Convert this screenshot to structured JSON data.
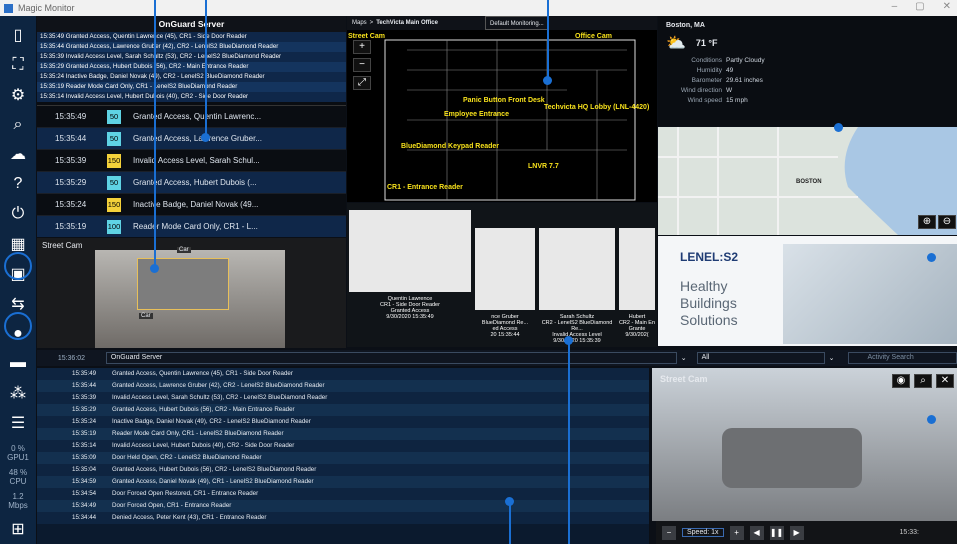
{
  "app": {
    "title": "Magic Monitor"
  },
  "sidebar": {
    "stats": [
      {
        "value": "0 %",
        "label": "GPU1"
      },
      {
        "value": "48 %",
        "label": "CPU"
      },
      {
        "value": "1.2",
        "label": "Mbps"
      }
    ]
  },
  "onguard_top": {
    "title": "OnGuard Server",
    "events": [
      "15:35:49  Granted Access, Quentin Lawrence (45), CR1 - Side Door Reader",
      "15:35:44  Granted Access, Lawrence Gruber (42), CR2 - LenelS2 BlueDiamond Reader",
      "15:35:39  Invalid Access Level, Sarah Schultz (53), CR2 - LenelS2 BlueDiamond Reader",
      "15:35:29  Granted Access, Hubert Dubois (56), CR2 - Main Entrance Reader",
      "15:35:24  Inactive Badge, Daniel Novak (49), CR2 - LenelS2 BlueDiamond Reader",
      "15:35:19  Reader Mode Card Only, CR1 - LenelS2 BlueDiamond Reader",
      "15:35:14  Invalid Access Level, Hubert Dubois (40), CR2 - Side Door Reader"
    ],
    "table": [
      {
        "time": "15:35:49",
        "num": "50",
        "color": "g",
        "text": "Granted Access, Quentin Lawrenc..."
      },
      {
        "time": "15:35:44",
        "num": "50",
        "color": "g",
        "text": "Granted Access, Lawrence Gruber..."
      },
      {
        "time": "15:35:39",
        "num": "150",
        "color": "y",
        "text": "Invalid Access Level, Sarah Schul..."
      },
      {
        "time": "15:35:29",
        "num": "50",
        "color": "g",
        "text": "Granted Access, Hubert Dubois (..."
      },
      {
        "time": "15:35:24",
        "num": "150",
        "color": "y",
        "text": "Inactive Badge, Daniel Novak (49..."
      },
      {
        "time": "15:35:19",
        "num": "100",
        "color": "g",
        "text": "Reader Mode Card Only, CR1 - L..."
      }
    ]
  },
  "street_cam_small": {
    "title": "Street Cam",
    "tag1": "Car",
    "tag2": "Car"
  },
  "map": {
    "breadcrumb_root": "Maps",
    "breadcrumb_sep": ">",
    "breadcrumb_page": "TechVicta Main Office",
    "dropdown": "Default Monitoring...",
    "labels": [
      "Street Cam",
      "Office Cam",
      "Panic Button Front Desk",
      "Techvicta HQ Lobby (LNL-4420)",
      "Employee Entrance",
      "BlueDiamond Keypad Reader",
      "LNVR 7.7",
      "CR1 - Entrance Reader"
    ]
  },
  "weather": {
    "location": "Boston, MA",
    "temp": "71 °F",
    "rows": [
      [
        "Conditions",
        "Partly Cloudy"
      ],
      [
        "Humidity",
        "49"
      ],
      [
        "Barometer",
        "29.61 inches"
      ],
      [
        "Wind direction",
        "W"
      ],
      [
        "Wind speed",
        "15 mph"
      ]
    ],
    "city": "BOSTON"
  },
  "badges": [
    {
      "name": "Quentin Lawrence",
      "reader": "CR1 - Side Door Reader",
      "status": "Granted Access",
      "time": "9/30/2020 15:35:49"
    },
    {
      "name": "nce Gruber",
      "reader": "BlueDiamond Re...",
      "status": "ed Access",
      "time": "20 15:35:44"
    },
    {
      "name": "Sarah Schultz",
      "reader": "CR2 - LenelS2 BlueDiamond Re...",
      "status": "Invalid Access Level",
      "time": "9/30/2020 15:35:39"
    },
    {
      "name": "Hubert",
      "reader": "CR2 - Main En",
      "status": "Grante",
      "time": "9/30/202("
    }
  ],
  "ad": {
    "brand": "LENEL:S2",
    "line1": "Healthy",
    "line2": "Buildings",
    "line3": "Solutions"
  },
  "activity": {
    "time": "15:36:02",
    "server": "OnGuard Server",
    "filter": "All",
    "search_placeholder": "Activity Search",
    "rows": [
      [
        "15:35:49",
        "Granted Access, Quentin Lawrence (45), CR1 - Side Door Reader"
      ],
      [
        "15:35:44",
        "Granted Access, Lawrence Gruber (42), CR2 - LenelS2 BlueDiamond Reader"
      ],
      [
        "15:35:39",
        "Invalid Access Level, Sarah Schultz (53), CR2 - LenelS2 BlueDiamond Reader"
      ],
      [
        "15:35:29",
        "Granted Access, Hubert Dubois (56), CR2 - Main Entrance Reader"
      ],
      [
        "15:35:24",
        "Inactive Badge, Daniel Novak (49), CR2 - LenelS2 BlueDiamond Reader"
      ],
      [
        "15:35:19",
        "Reader Mode Card Only, CR1 - LenelS2 BlueDiamond Reader"
      ],
      [
        "15:35:14",
        "Invalid Access Level, Hubert Dubois (40), CR2 - Side Door Reader"
      ],
      [
        "15:35:09",
        "Door Held Open, CR2 - LenelS2 BlueDiamond Reader"
      ],
      [
        "15:35:04",
        "Granted Access, Hubert Dubois (56), CR2 - LenelS2 BlueDiamond Reader"
      ],
      [
        "15:34:59",
        "Granted Access, Daniel Novak (49), CR1 - LenelS2 BlueDiamond Reader"
      ],
      [
        "15:34:54",
        "Door Forced Open Restored, CR1 - Entrance Reader"
      ],
      [
        "15:34:49",
        "Door Forced Open, CR1 - Entrance Reader"
      ],
      [
        "15:34:44",
        "Denied Access, Peter Kent (43), CR1 - Entrance Reader"
      ]
    ]
  },
  "street_cam_big": {
    "title": "Street Cam",
    "speed": "Speed: 1x",
    "time": "15:33:"
  }
}
